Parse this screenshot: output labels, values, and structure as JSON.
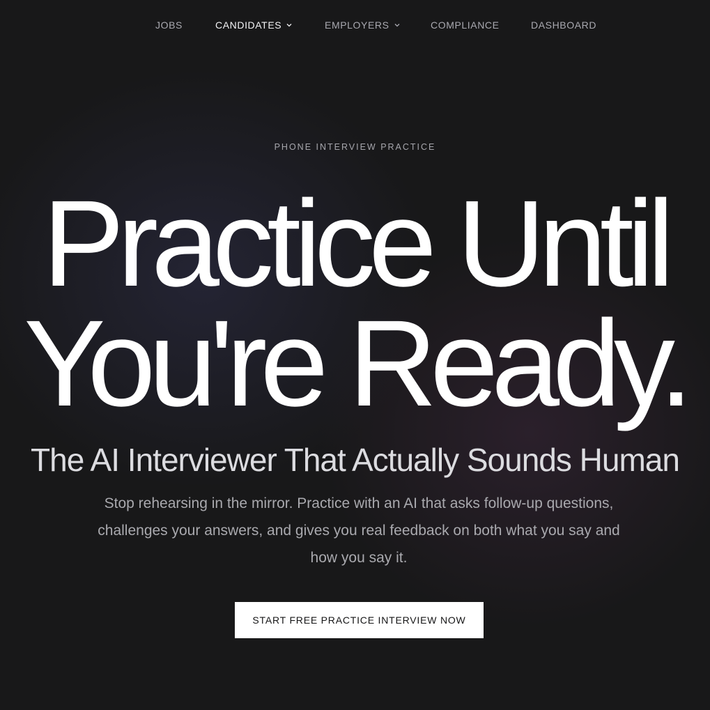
{
  "nav": {
    "items": [
      {
        "label": "JOBS",
        "has_dropdown": false,
        "active": false
      },
      {
        "label": "CANDIDATES",
        "has_dropdown": true,
        "active": true
      },
      {
        "label": "EMPLOYERS",
        "has_dropdown": true,
        "active": false
      },
      {
        "label": "COMPLIANCE",
        "has_dropdown": false,
        "active": false
      },
      {
        "label": "DASHBOARD",
        "has_dropdown": false,
        "active": false
      }
    ]
  },
  "hero": {
    "eyebrow": "PHONE INTERVIEW PRACTICE",
    "headline_line1": "Practice Until",
    "headline_line2": "You're Ready.",
    "subheadline": "The AI Interviewer That Actually Sounds Human",
    "body": "Stop rehearsing in the mirror. Practice with an AI that asks follow-up questions, challenges your answers, and gives you real feedback on both what you say and how you say it.",
    "cta_label": "START FREE PRACTICE INTERVIEW NOW"
  },
  "colors": {
    "background": "#181819",
    "text_primary": "#ffffff",
    "text_muted": "#a9a9ae",
    "cta_background": "#ffffff",
    "cta_text": "#151516"
  },
  "icons": {
    "dropdown": "chevron-down-icon"
  }
}
